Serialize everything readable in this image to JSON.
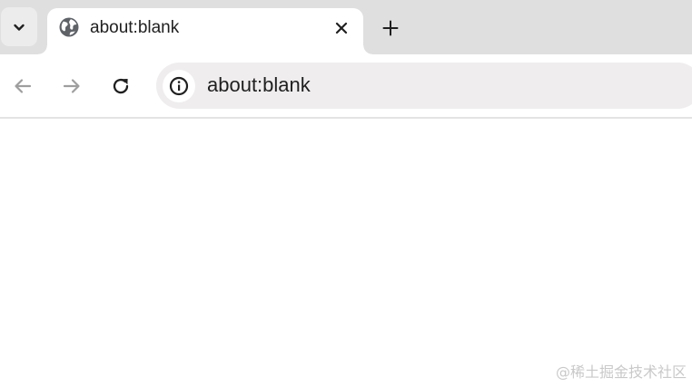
{
  "tabstrip": {
    "tab_search_icon": "chevron-down-icon",
    "tabs": [
      {
        "title": "about:blank",
        "favicon": "globe-icon",
        "close_icon": "close-icon",
        "active": true
      }
    ],
    "new_tab_icon": "plus-icon"
  },
  "toolbar": {
    "back_icon": "arrow-left-icon",
    "forward_icon": "arrow-right-icon",
    "reload_icon": "reload-icon",
    "site_info_icon": "info-icon",
    "address": "about:blank"
  },
  "watermark": "@稀土掘金技术社区",
  "colors": {
    "tab_strip_bg": "#dfdfdf",
    "active_tab_bg": "#ffffff",
    "omnibox_bg": "#efeded",
    "text": "#1f1f1f",
    "icon": "#5f6368",
    "disabled_icon": "#9e9e9e"
  }
}
